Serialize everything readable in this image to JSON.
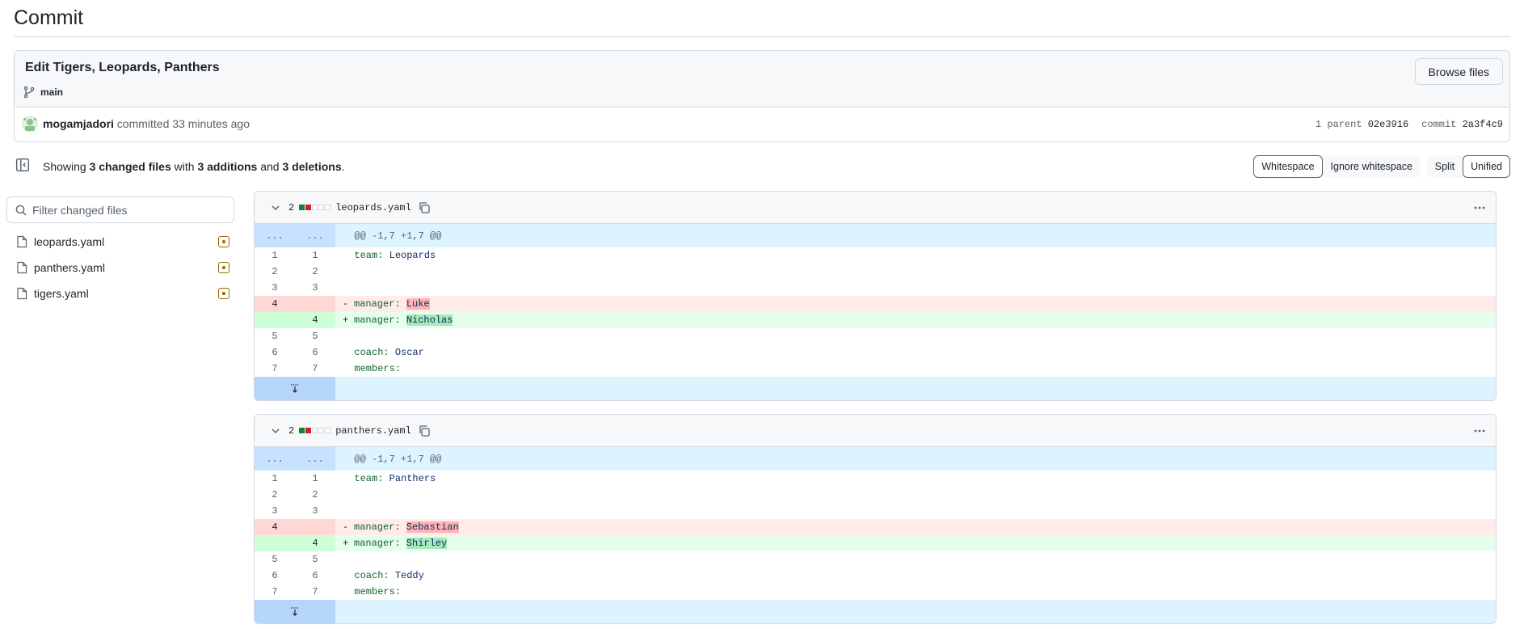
{
  "page": {
    "title": "Commit"
  },
  "commit": {
    "message": "Edit Tigers, Leopards, Panthers",
    "branch": "main",
    "browse_label": "Browse files",
    "author": "mogamjadori",
    "committed_text": "committed 33 minutes ago",
    "parent_label": "1 parent",
    "parent_sha": "02e3916",
    "commit_label": "commit",
    "commit_sha": "2a3f4c9"
  },
  "summary": {
    "showing": "Showing",
    "changed_files": "3 changed files",
    "with": "with",
    "additions": "3 additions",
    "and": "and",
    "deletions": "3 deletions",
    "period": "."
  },
  "controls": {
    "whitespace": "Whitespace",
    "ignore_whitespace": "Ignore whitespace",
    "split": "Split",
    "unified": "Unified"
  },
  "filter": {
    "placeholder": "Filter changed files"
  },
  "files": [
    {
      "name": "leopards.yaml"
    },
    {
      "name": "panthers.yaml"
    },
    {
      "name": "tigers.yaml"
    }
  ],
  "diffs": [
    {
      "count": "2",
      "path": "leopards.yaml",
      "hunk_marker": "...",
      "hunk": "@@ -1,7 +1,7 @@",
      "lines": {
        "l1": {
          "old": "1",
          "new": "1",
          "key": "team",
          "val": "Leopards"
        },
        "l2": {
          "old": "2",
          "new": "2"
        },
        "l3": {
          "old": "3",
          "new": "3"
        },
        "del": {
          "old": "4",
          "sign": "-",
          "key": "manager",
          "val": "Luke"
        },
        "add": {
          "new": "4",
          "sign": "+",
          "key": "manager",
          "val": "Nicholas"
        },
        "l5": {
          "old": "5",
          "new": "5"
        },
        "l6": {
          "old": "6",
          "new": "6",
          "key": "coach",
          "val": "Oscar"
        },
        "l7": {
          "old": "7",
          "new": "7",
          "key": "members"
        }
      }
    },
    {
      "count": "2",
      "path": "panthers.yaml",
      "hunk_marker": "...",
      "hunk": "@@ -1,7 +1,7 @@",
      "lines": {
        "l1": {
          "old": "1",
          "new": "1",
          "key": "team",
          "val": "Panthers"
        },
        "l2": {
          "old": "2",
          "new": "2"
        },
        "l3": {
          "old": "3",
          "new": "3"
        },
        "del": {
          "old": "4",
          "sign": "-",
          "key": "manager",
          "val": "Sebastian"
        },
        "add": {
          "new": "4",
          "sign": "+",
          "key": "manager",
          "val": "Shirley"
        },
        "l5": {
          "old": "5",
          "new": "5"
        },
        "l6": {
          "old": "6",
          "new": "6",
          "key": "coach",
          "val": "Teddy"
        },
        "l7": {
          "old": "7",
          "new": "7",
          "key": "members"
        }
      }
    }
  ],
  "colors": {
    "addition": "#1a7f37",
    "deletion": "#cf222e",
    "modified": "#9a6700",
    "hunk": "#ddf4ff"
  }
}
